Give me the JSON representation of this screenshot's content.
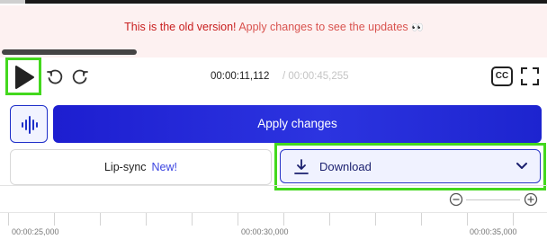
{
  "banner": {
    "strong_text": "This is the old version!",
    "rest_text": "Apply changes to see the updates",
    "emoji": "👀"
  },
  "player": {
    "playback_progress": 0.25,
    "current_time": "00:00:11,112",
    "total_time": "/ 00:00:45,255",
    "cc_label": "CC",
    "icons": [
      "play-icon",
      "rewind-icon",
      "forward-icon",
      "fullscreen-icon"
    ]
  },
  "actions": {
    "apply_label": "Apply changes",
    "lipsync_label": "Lip-sync",
    "lipsync_badge": "New!",
    "download_label": "Download"
  },
  "timeline": {
    "labels": [
      "00:00:25,000",
      "00:00:30,000",
      "00:00:35,000"
    ]
  },
  "colors": {
    "accent": "#1e2fc9",
    "highlight": "#43d81e",
    "banner_text": "#c81e1e"
  }
}
